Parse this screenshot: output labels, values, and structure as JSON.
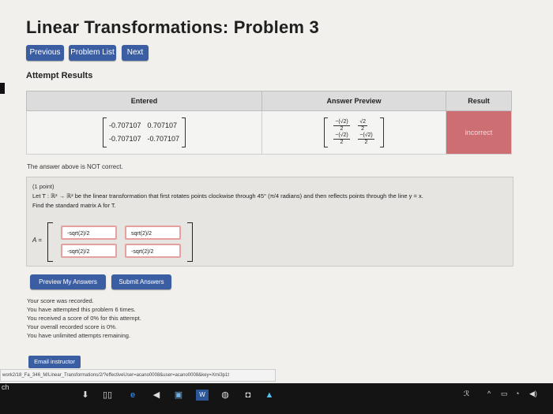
{
  "page_title": "Linear Transformations: Problem 3",
  "nav": {
    "previous": "Previous",
    "problem_list": "Problem List",
    "next": "Next"
  },
  "attempt_results": {
    "title": "Attempt Results",
    "headers": {
      "entered": "Entered",
      "preview": "Answer Preview",
      "result": "Result"
    },
    "entered_matrix": [
      [
        "-0.707107",
        "0.707107"
      ],
      [
        "-0.707107",
        "-0.707107"
      ]
    ],
    "preview": {
      "r1c1_num": "−(√2)",
      "r1c1_den": "2",
      "r1c2_num": "√2",
      "r1c2_den": "2",
      "r2c1_num": "−(√2)",
      "r2c1_den": "2",
      "r2c2_num": "−(√2)",
      "r2c2_den": "2"
    },
    "result": "incorrect",
    "message": "The answer above is NOT correct."
  },
  "problem": {
    "points": "(1 point)",
    "statement": "Let T : ℝ² → ℝ² be the linear transformation that first rotates points clockwise through 45° (π/4 radians) and then reflects points through the line y = x.",
    "find": "Find the standard matrix A for T.",
    "matrix_label": "A =",
    "answers": {
      "a11": "-sqrt(2)/2",
      "a12": "sqrt(2)/2",
      "a21": "-sqrt(2)/2",
      "a22": "-sqrt(2)/2"
    }
  },
  "actions": {
    "preview": "Preview My Answers",
    "submit": "Submit Answers"
  },
  "status": {
    "l1": "Your score was recorded.",
    "l2": "You have attempted this problem 6 times.",
    "l3": "You received a score of 0% for this attempt.",
    "l4": "Your overall recorded score is 0%.",
    "l5": "You have unlimited attempts remaining."
  },
  "email_instructor": "Email instructor",
  "url": "work2/18_Fa_346_M/Linear_Transformations/2/?effectiveUser=acano0008&user=acano0008&key=Xmi3p1t",
  "taskbar": {
    "search": "ch"
  },
  "colors": {
    "button": "#3b5ea3",
    "incorrect": "#cc6e72",
    "answer_border": "#e7a0a0"
  }
}
